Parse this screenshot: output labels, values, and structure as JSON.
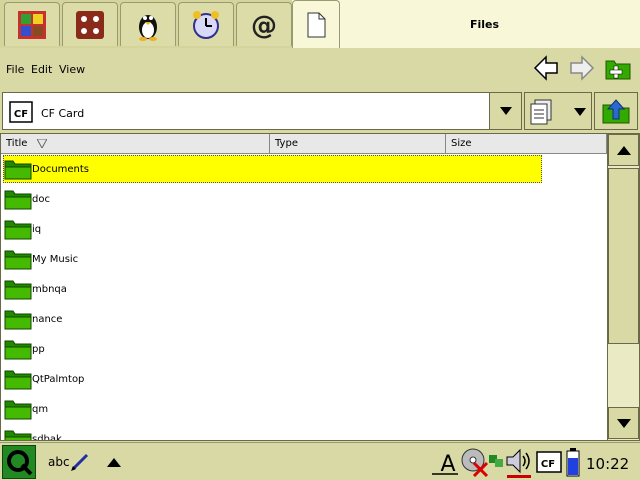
{
  "app_title": "Files",
  "launcher_tabs": [
    {
      "icon": "applications-icon"
    },
    {
      "icon": "games-icon"
    },
    {
      "icon": "linux-penguin-icon"
    },
    {
      "icon": "alarm-clock-icon"
    },
    {
      "icon": "email-at-icon"
    },
    {
      "icon": "document-icon"
    }
  ],
  "menubar": {
    "file": "File",
    "edit": "Edit",
    "view": "View"
  },
  "location": {
    "label": "CF Card",
    "device_badge": "CF"
  },
  "columns": {
    "title": "Title",
    "type": "Type",
    "size": "Size"
  },
  "files": [
    {
      "name": "Documents",
      "selected": true
    },
    {
      "name": "doc"
    },
    {
      "name": "iq"
    },
    {
      "name": "My Music"
    },
    {
      "name": "mbnqa"
    },
    {
      "name": "nance"
    },
    {
      "name": "pp"
    },
    {
      "name": "QtPalmtop"
    },
    {
      "name": "qm"
    },
    {
      "name": "sdbak"
    }
  ],
  "taskbar": {
    "input_method": "abc",
    "clock": "10:22",
    "cf_badge": "CF",
    "keyboard_letter": "A"
  },
  "colors": {
    "selection": "#ffff00",
    "folder": "#33aa00",
    "chrome": "#d9d9a6"
  }
}
